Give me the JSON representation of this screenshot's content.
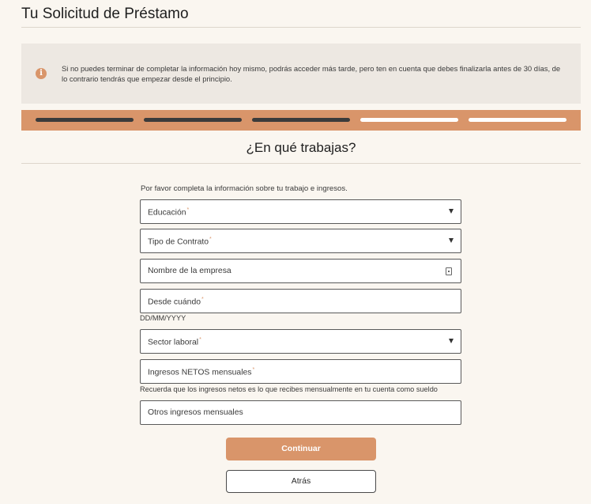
{
  "header": {
    "title": "Tu Solicitud de Préstamo"
  },
  "notice": {
    "icon": "info-icon",
    "text": "Si no puedes terminar de completar la información hoy mismo, podrás acceder más tarde, pero ten en cuenta que debes finalizarla antes de 30 días, de lo contrario tendrás que empezar desde el principio."
  },
  "progress": {
    "total_steps": 5,
    "completed_steps": 3,
    "bar_color": "#d9956a"
  },
  "section": {
    "title": "¿En qué trabajas?",
    "intro": "Por favor completa la información sobre tu trabajo e ingresos."
  },
  "form": {
    "education": {
      "label": "Educación",
      "required_mark": "*"
    },
    "contract_type": {
      "label": "Tipo de Contrato",
      "required_mark": "*"
    },
    "company_name": {
      "label": "Nombre de la empresa"
    },
    "since_when": {
      "label": "Desde cuándo",
      "required_mark": "*",
      "hint": "DD/MM/YYYY"
    },
    "work_sector": {
      "label": "Sector laboral",
      "required_mark": "*"
    },
    "net_income": {
      "label": "Ingresos NETOS mensuales",
      "required_mark": "*",
      "hint": "Recuerda que los ingresos netos es lo que recibes mensualmente en tu cuenta como sueldo"
    },
    "other_income": {
      "label": "Otros ingresos mensuales"
    }
  },
  "actions": {
    "continue_label": "Continuar",
    "back_label": "Atrás"
  }
}
